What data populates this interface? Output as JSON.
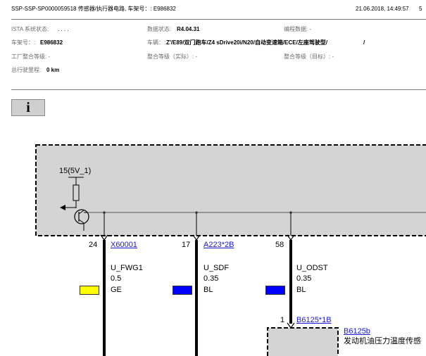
{
  "header": {
    "title": "SSP-SSP-SP0000059518 传感器/执行器电路, 车架号：: E986832",
    "datetime": "21.06.2018, 14:49:57",
    "page": "5"
  },
  "info": {
    "ista_label": "ISTA 系统状态:",
    "ista_value": ". . . .",
    "datastate_label": "数据状态:",
    "datastate_value": "R4.04.31",
    "programming_label": "编程数据: -",
    "vin_label": "车架号：:",
    "vin_value": "E986832",
    "vehicle_label": "车辆：:",
    "vehicle_value": "Z'/E89/双门跑车/Z4 sDrive20i/N20/自动变速箱/ECE/左座驾驶型/",
    "vehicle_tail": "/",
    "factory_label": "工厂整合等级: -",
    "integration_actual_label": "整合等级（实际）: -",
    "integration_target_label": "整合等级（目标）: -",
    "mileage_label": "总行驶里程:",
    "mileage_value": "0 km"
  },
  "info_button": {
    "glyph": "i"
  },
  "schematic": {
    "supply_label": "15(5V_1)",
    "pins": [
      {
        "pin": "24",
        "connector": "X60001",
        "wire_name": "U_FWG1",
        "cross_section": "0.5",
        "color_code": "GE",
        "color_hex": "#ffff00"
      },
      {
        "pin": "17",
        "connector": "A223*2B",
        "wire_name": "U_SDF",
        "cross_section": "0.35",
        "color_code": "BL",
        "color_hex": "#0000ff"
      },
      {
        "pin": "58",
        "connector": "",
        "wire_name": "U_ODST",
        "cross_section": "0.35",
        "color_code": "BL",
        "color_hex": "#0000ff"
      }
    ],
    "sensor_pin": "1",
    "sensor_connector": "B6125*1B",
    "sensor_id": "B6125b",
    "sensor_name": "发动机油压力温度传感"
  },
  "colors": {
    "module_fill": "#d4d4d4",
    "link": "#1a1acc"
  }
}
